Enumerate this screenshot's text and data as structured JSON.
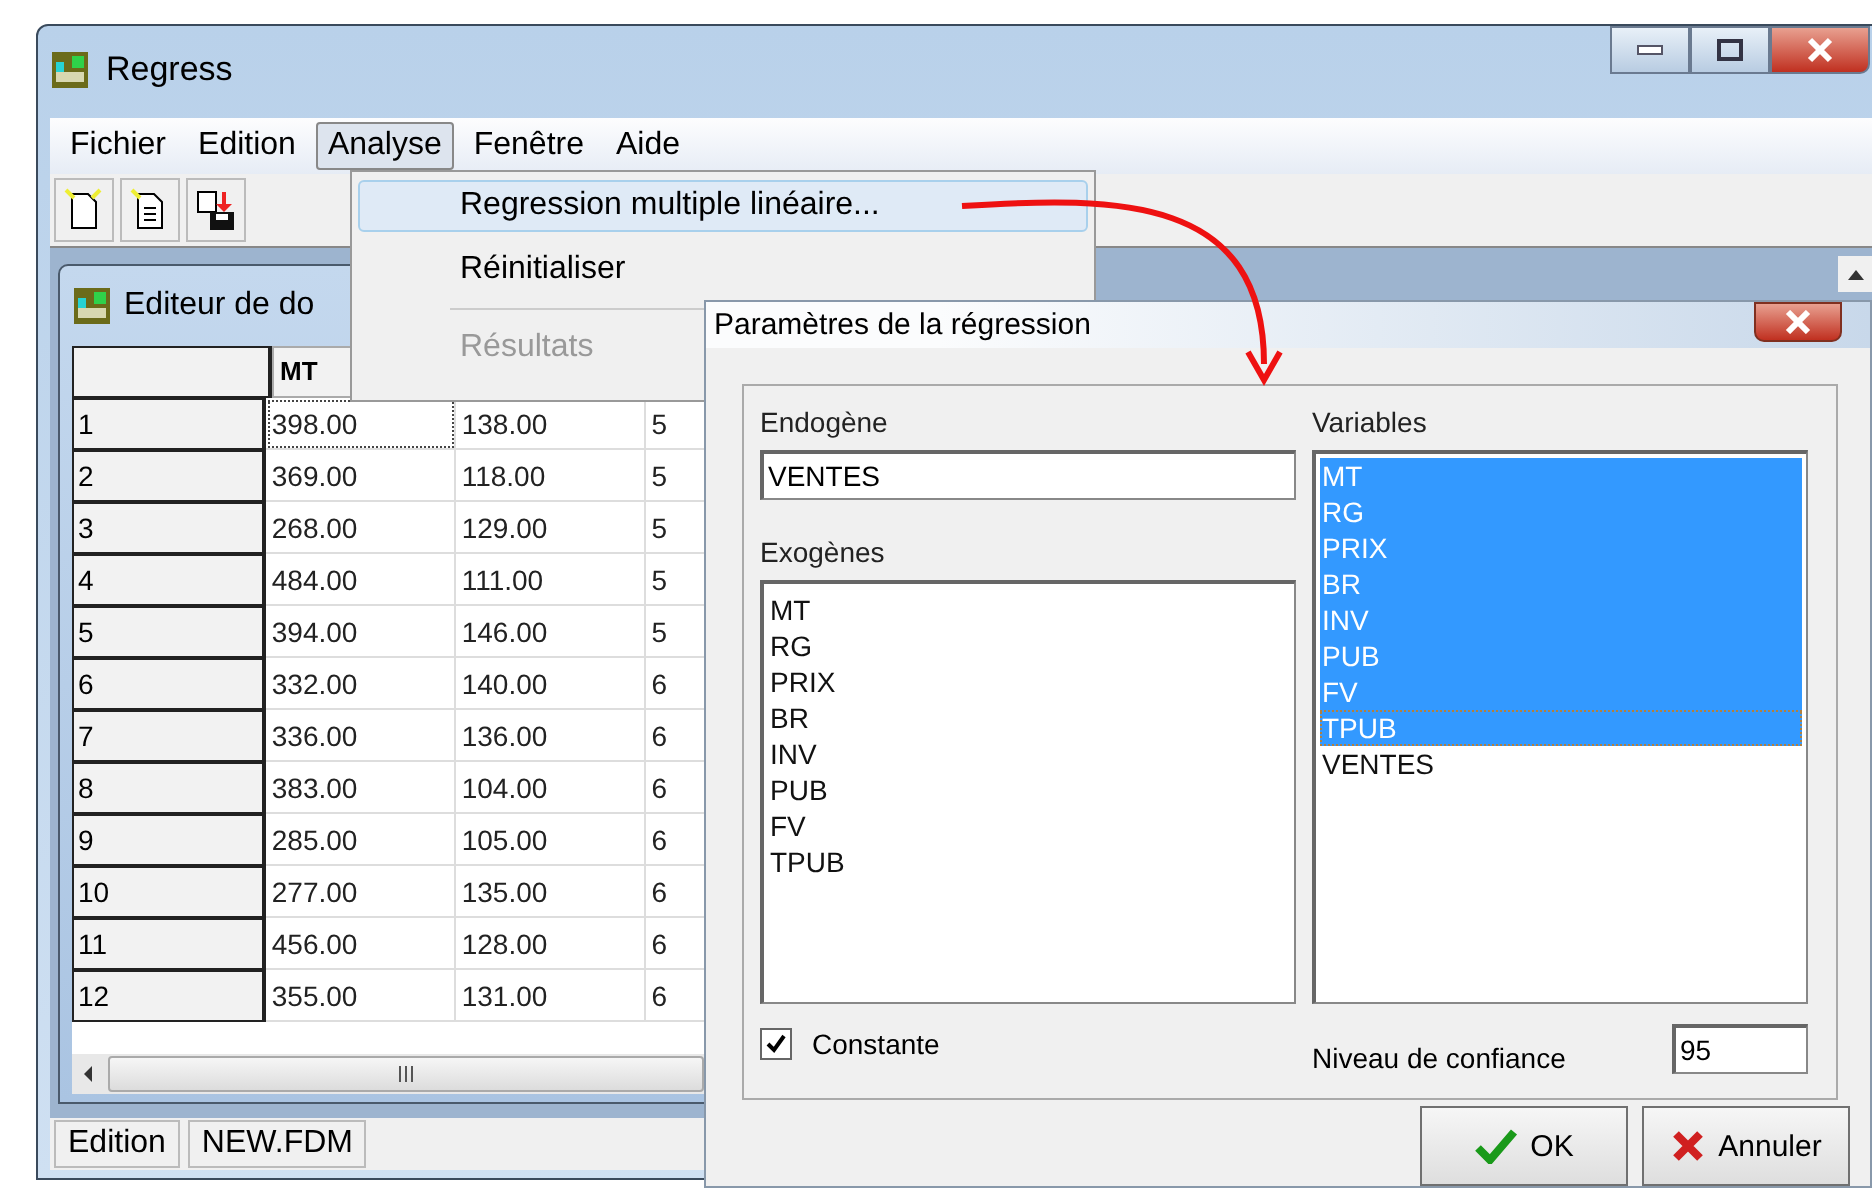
{
  "window": {
    "title": "Regress"
  },
  "menu_bar": [
    {
      "label": "Fichier",
      "selected": false
    },
    {
      "label": "Edition",
      "selected": false
    },
    {
      "label": "Analyse",
      "selected": true
    },
    {
      "label": "Fenêtre",
      "selected": false
    },
    {
      "label": "Aide",
      "selected": false
    }
  ],
  "dropdown": [
    {
      "label": "Regression multiple linéaire...",
      "highlighted": true,
      "disabled": false
    },
    {
      "label": "Réinitialiser",
      "highlighted": false,
      "disabled": false
    },
    {
      "label": "Résultats",
      "highlighted": false,
      "disabled": true
    }
  ],
  "data_editor": {
    "title": "Editeur de do",
    "columns": [
      "MT"
    ],
    "rows": [
      {
        "label": "1",
        "cells": [
          "398.00",
          "138.00",
          "5"
        ]
      },
      {
        "label": "2",
        "cells": [
          "369.00",
          "118.00",
          "5"
        ]
      },
      {
        "label": "3",
        "cells": [
          "268.00",
          "129.00",
          "5"
        ]
      },
      {
        "label": "4",
        "cells": [
          "484.00",
          "111.00",
          "5"
        ]
      },
      {
        "label": "5",
        "cells": [
          "394.00",
          "146.00",
          "5"
        ]
      },
      {
        "label": "6",
        "cells": [
          "332.00",
          "140.00",
          "6"
        ]
      },
      {
        "label": "7",
        "cells": [
          "336.00",
          "136.00",
          "6"
        ]
      },
      {
        "label": "8",
        "cells": [
          "383.00",
          "104.00",
          "6"
        ]
      },
      {
        "label": "9",
        "cells": [
          "285.00",
          "105.00",
          "6"
        ]
      },
      {
        "label": "10",
        "cells": [
          "277.00",
          "135.00",
          "6"
        ]
      },
      {
        "label": "11",
        "cells": [
          "456.00",
          "128.00",
          "6"
        ]
      },
      {
        "label": "12",
        "cells": [
          "355.00",
          "131.00",
          "6"
        ]
      }
    ]
  },
  "status_bar": [
    "Edition",
    "NEW.FDM"
  ],
  "dialog": {
    "title": "Paramètres de la régression",
    "endogene": {
      "label": "Endogène",
      "value": "VENTES"
    },
    "exogenes": {
      "label": "Exogènes",
      "items": [
        "MT",
        "RG",
        "PRIX",
        "BR",
        "INV",
        "PUB",
        "FV",
        "TPUB"
      ]
    },
    "constante": {
      "label": "Constante",
      "checked": true
    },
    "variables": {
      "label": "Variables",
      "items": [
        {
          "label": "MT",
          "selected": true
        },
        {
          "label": "RG",
          "selected": true
        },
        {
          "label": "PRIX",
          "selected": true
        },
        {
          "label": "BR",
          "selected": true
        },
        {
          "label": "INV",
          "selected": true
        },
        {
          "label": "PUB",
          "selected": true
        },
        {
          "label": "FV",
          "selected": true
        },
        {
          "label": "TPUB",
          "selected": true
        },
        {
          "label": "VENTES",
          "selected": false
        }
      ]
    },
    "confidence": {
      "label": "Niveau de confiance",
      "value": "95"
    },
    "buttons": [
      {
        "kind": "ok",
        "label": "OK"
      },
      {
        "kind": "cancel",
        "label": "Annuler"
      }
    ]
  }
}
